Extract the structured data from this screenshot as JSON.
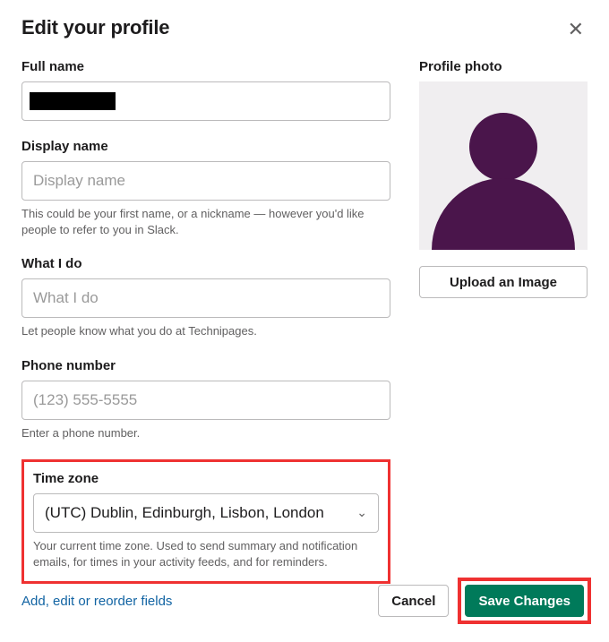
{
  "header": {
    "title": "Edit your profile"
  },
  "full_name": {
    "label": "Full name",
    "value": ""
  },
  "display_name": {
    "label": "Display name",
    "placeholder": "Display name",
    "helper": "This could be your first name, or a nickname — however you'd like people to refer to you in Slack."
  },
  "what_i_do": {
    "label": "What I do",
    "placeholder": "What I do",
    "helper": "Let people know what you do at Technipages."
  },
  "phone": {
    "label": "Phone number",
    "placeholder": "(123) 555-5555",
    "helper": "Enter a phone number."
  },
  "timezone": {
    "label": "Time zone",
    "value": "(UTC) Dublin, Edinburgh, Lisbon, London",
    "helper": "Your current time zone. Used to send summary and notification emails, for times in your activity feeds, and for reminders."
  },
  "profile_photo": {
    "label": "Profile photo",
    "upload_label": "Upload an Image"
  },
  "footer": {
    "reorder_link": "Add, edit or reorder fields",
    "cancel_label": "Cancel",
    "save_label": "Save Changes"
  },
  "colors": {
    "highlight": "#ef3131",
    "primary_button": "#007a5a",
    "avatar": "#4a154b"
  }
}
